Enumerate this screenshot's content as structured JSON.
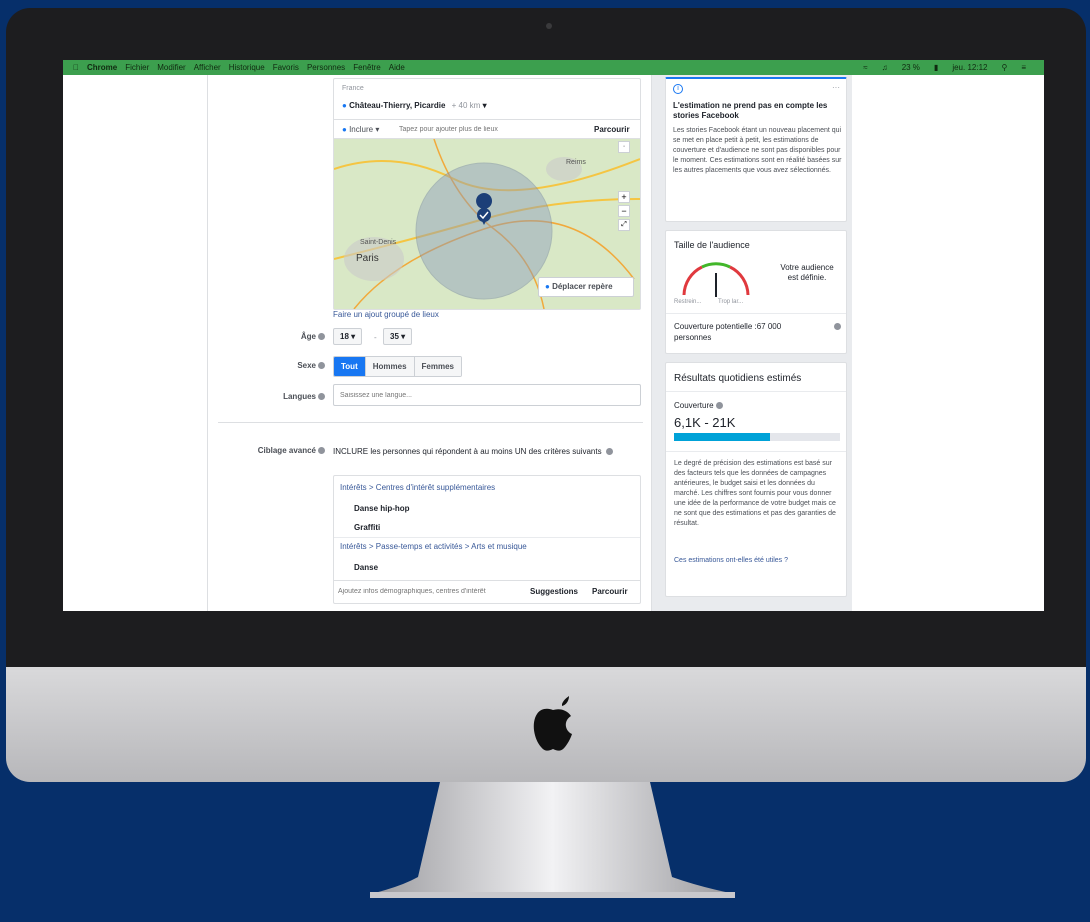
{
  "menubar": {
    "items": [
      "Chrome",
      "Fichier",
      "Modifier",
      "Afficher",
      "Historique",
      "Favoris",
      "Personnes",
      "Fenêtre",
      "Aide"
    ],
    "battery": "23 %",
    "clock": "jeu. 12:12"
  },
  "location": {
    "country": "France",
    "place": "Château-Thierry, Picardie",
    "radius": "+ 40 km",
    "include_label": "Inclure",
    "add_placeholder": "Tapez pour ajouter plus de lieux",
    "browse_label": "Parcourir",
    "map_labels": [
      "Reims",
      "Saint-Denis",
      "Paris"
    ],
    "move_pin_label": "Déplacer repère",
    "bulk_link": "Faire un ajout groupé de lieux"
  },
  "age": {
    "label": "Âge",
    "min": "18",
    "max": "35",
    "separator": "-"
  },
  "gender": {
    "label": "Sexe",
    "options": [
      "Tout",
      "Hommes",
      "Femmes"
    ],
    "selected": "Tout"
  },
  "languages": {
    "label": "Langues",
    "placeholder": "Saisissez une langue..."
  },
  "advanced": {
    "label": "Ciblage avancé",
    "description": "INCLURE les personnes qui répondent à au moins UN des critères suivants",
    "groups": [
      {
        "path": "Intérêts > Centres d'intérêt supplémentaires",
        "items": [
          "Danse hip-hop",
          "Graffiti"
        ]
      },
      {
        "path": "Intérêts > Passe-temps et activités > Arts et musique",
        "items": [
          "Danse"
        ]
      }
    ],
    "input_placeholder": "Ajoutez infos démographiques, centres d'intérêt",
    "suggestions_label": "Suggestions",
    "browse_label": "Parcourir"
  },
  "notice": {
    "more": "···",
    "title": "L'estimation ne prend pas en compte les stories Facebook",
    "body": "Les stories Facebook étant un nouveau placement qui se met en place petit à petit, les estimations de couverture et d'audience ne sont pas disponibles pour le moment. Ces estimations sont en réalité basées sur les autres placements que vous avez sélectionnés."
  },
  "audience": {
    "title": "Taille de l'audience",
    "status": "Votre audience est définie.",
    "gauge_left": "Restrein...",
    "gauge_right": "Trop lar...",
    "gauge_level": 0.5,
    "coverage_line1": "Couverture potentielle :67 000",
    "coverage_line2": "personnes"
  },
  "daily": {
    "title": "Résultats quotidiens estimés",
    "coverage_label": "Couverture",
    "range": "6,1K - 21K",
    "bar_fill": 0.58,
    "body": "Le degré de précision des estimations est basé sur des facteurs tels que les données de campagnes antérieures, le budget saisi et les données du marché. Les chiffres sont fournis pour vous donner une idée de la performance de votre budget mais ce ne sont que des estimations et pas des garanties de résultat.",
    "feedback_link": "Ces estimations ont-elles été utiles ?"
  },
  "colors": {
    "accent": "#1877f2",
    "progress": "#00a2d8",
    "background": "#062f6a"
  }
}
